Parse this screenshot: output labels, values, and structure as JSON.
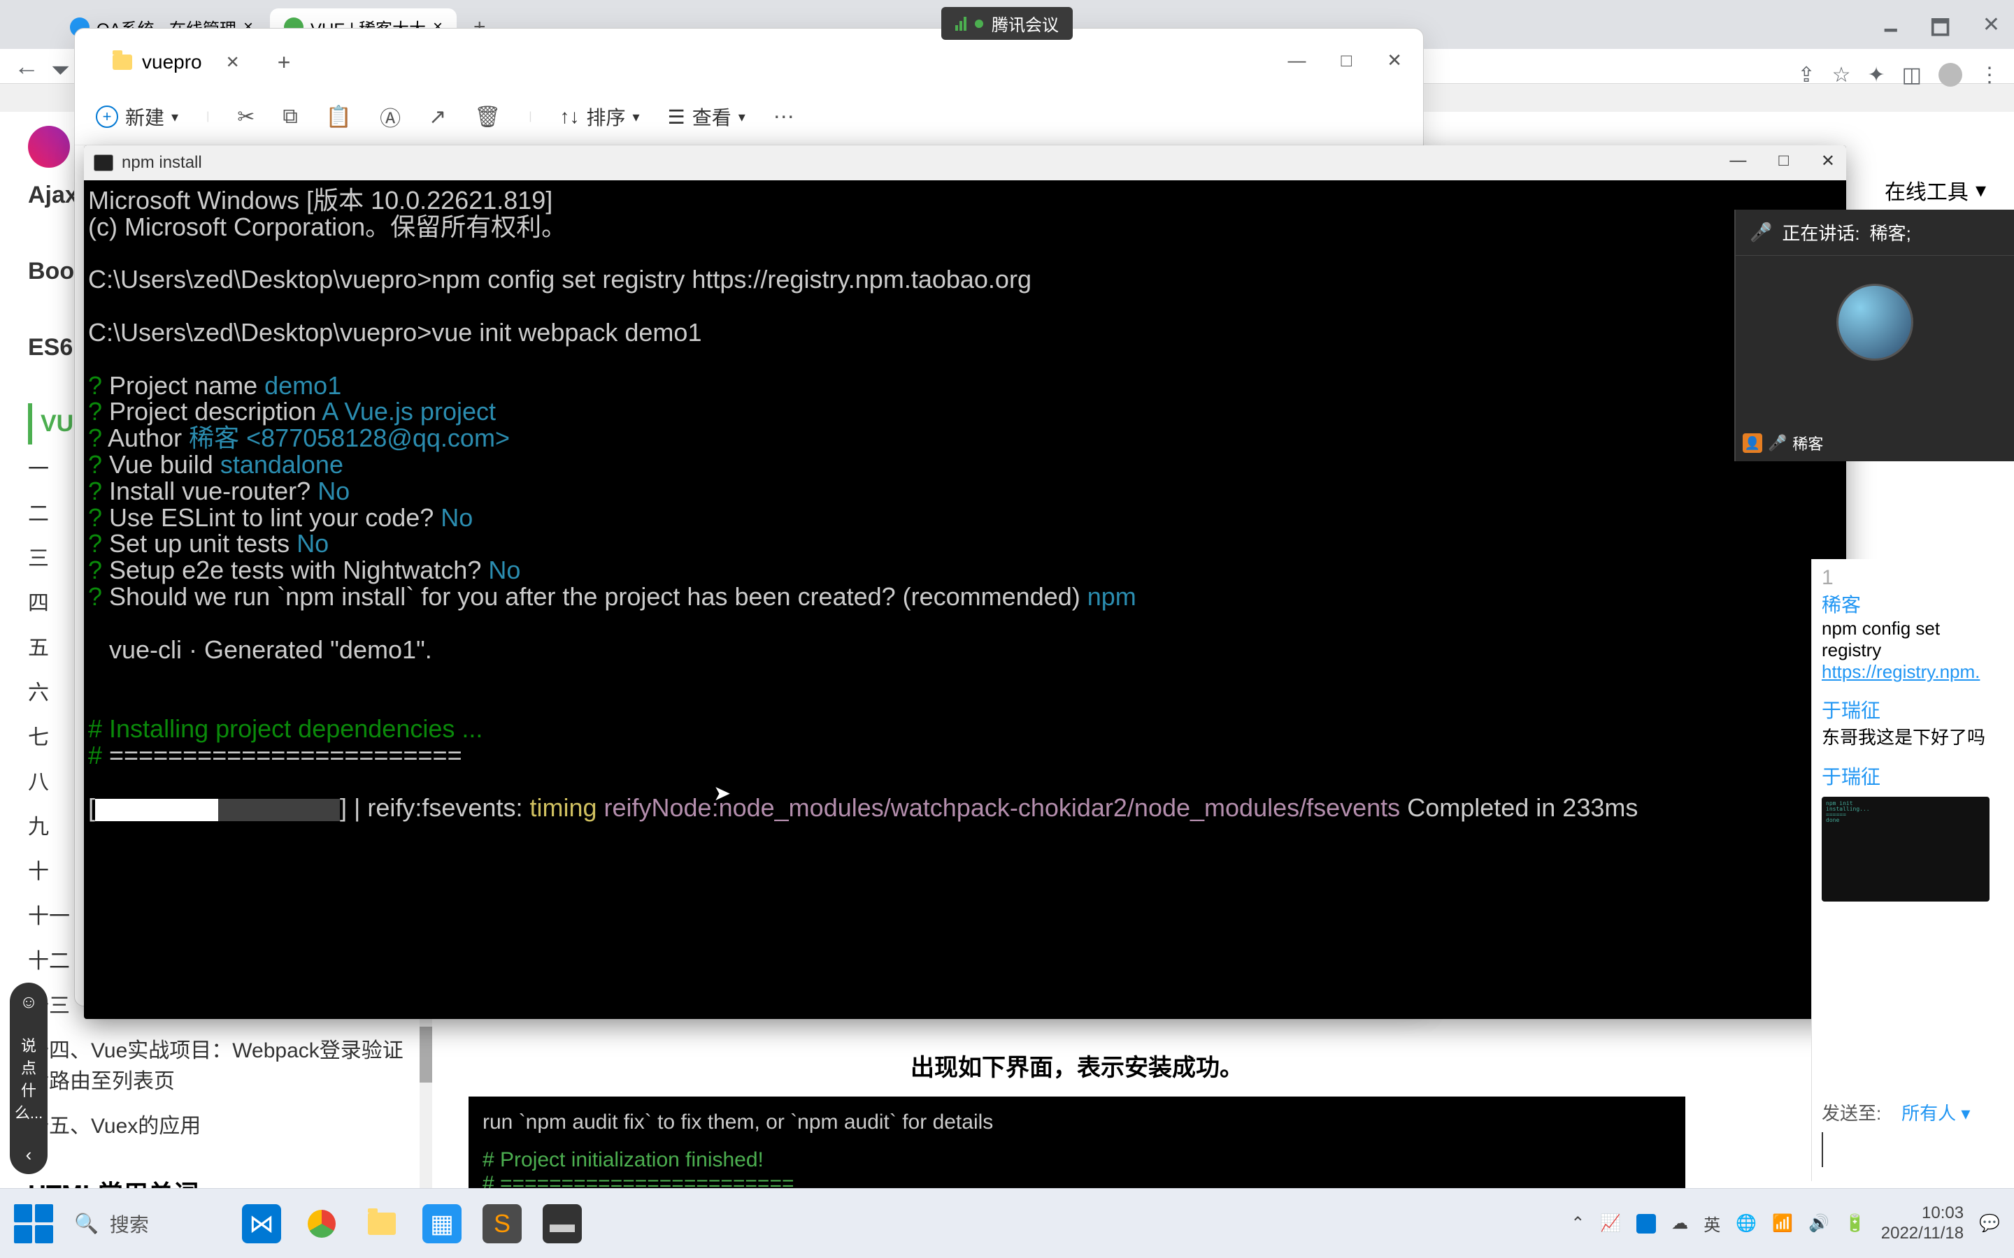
{
  "tencent_bar": {
    "label": "腾讯会议"
  },
  "chrome": {
    "tabs": [
      {
        "label": "OA系统 · 在线管理"
      },
      {
        "label": "VUE | 稀客大大"
      }
    ],
    "controls": {
      "min": "—",
      "max": "□",
      "close": "✕"
    }
  },
  "explorer": {
    "tab_title": "vuepro",
    "new_btn": "新建",
    "sort_btn": "排序",
    "view_btn": "查看",
    "controls": {
      "min": "—",
      "max": "□",
      "close": "✕"
    }
  },
  "terminal": {
    "title": "npm install",
    "lines": [
      {
        "segments": [
          {
            "t": "Microsoft Windows [版本 10.0.22621.819]",
            "c": "plain"
          }
        ]
      },
      {
        "segments": [
          {
            "t": "(c) Microsoft Corporation。保留所有权利。",
            "c": "plain"
          }
        ]
      },
      {
        "segments": [
          {
            "t": "",
            "c": "plain"
          }
        ]
      },
      {
        "segments": [
          {
            "t": "C:\\Users\\zed\\Desktop\\vuepro>",
            "c": "plain"
          },
          {
            "t": "npm config set registry https://registry.npm.taobao.org",
            "c": "plain"
          }
        ]
      },
      {
        "segments": [
          {
            "t": "",
            "c": "plain"
          }
        ]
      },
      {
        "segments": [
          {
            "t": "C:\\Users\\zed\\Desktop\\vuepro>",
            "c": "plain"
          },
          {
            "t": "vue init webpack demo1",
            "c": "plain"
          }
        ]
      },
      {
        "segments": [
          {
            "t": "",
            "c": "plain"
          }
        ]
      },
      {
        "segments": [
          {
            "t": "?",
            "c": "q"
          },
          {
            "t": " Project name ",
            "c": "plain"
          },
          {
            "t": "demo1",
            "c": "ans"
          }
        ]
      },
      {
        "segments": [
          {
            "t": "?",
            "c": "q"
          },
          {
            "t": " Project description ",
            "c": "plain"
          },
          {
            "t": "A Vue.js project",
            "c": "ans"
          }
        ]
      },
      {
        "segments": [
          {
            "t": "?",
            "c": "q"
          },
          {
            "t": " Author ",
            "c": "plain"
          },
          {
            "t": "稀客 <877058128@qq.com>",
            "c": "ans"
          }
        ]
      },
      {
        "segments": [
          {
            "t": "?",
            "c": "q"
          },
          {
            "t": " Vue build ",
            "c": "plain"
          },
          {
            "t": "standalone",
            "c": "ans"
          }
        ]
      },
      {
        "segments": [
          {
            "t": "?",
            "c": "q"
          },
          {
            "t": " Install vue-router? ",
            "c": "plain"
          },
          {
            "t": "No",
            "c": "ans"
          }
        ]
      },
      {
        "segments": [
          {
            "t": "?",
            "c": "q"
          },
          {
            "t": " Use ESLint to lint your code? ",
            "c": "plain"
          },
          {
            "t": "No",
            "c": "ans"
          }
        ]
      },
      {
        "segments": [
          {
            "t": "?",
            "c": "q"
          },
          {
            "t": " Set up unit tests ",
            "c": "plain"
          },
          {
            "t": "No",
            "c": "ans"
          }
        ]
      },
      {
        "segments": [
          {
            "t": "?",
            "c": "q"
          },
          {
            "t": " Setup e2e tests with Nightwatch? ",
            "c": "plain"
          },
          {
            "t": "No",
            "c": "ans"
          }
        ]
      },
      {
        "segments": [
          {
            "t": "?",
            "c": "q"
          },
          {
            "t": " Should we run `npm install` for you after the project has been created? (recommended) ",
            "c": "plain"
          },
          {
            "t": "npm",
            "c": "ans"
          }
        ]
      },
      {
        "segments": [
          {
            "t": "",
            "c": "plain"
          }
        ]
      },
      {
        "segments": [
          {
            "t": "   vue-cli · Generated \"demo1\".",
            "c": "plain"
          }
        ]
      },
      {
        "segments": [
          {
            "t": "",
            "c": "plain"
          }
        ]
      },
      {
        "segments": [
          {
            "t": "",
            "c": "plain"
          }
        ]
      },
      {
        "segments": [
          {
            "t": "#",
            "c": "q"
          },
          {
            "t": " Installing project dependencies ...",
            "c": "q"
          }
        ]
      },
      {
        "segments": [
          {
            "t": "#",
            "c": "q"
          },
          {
            "t": " ========================",
            "c": "plain"
          }
        ]
      },
      {
        "segments": [
          {
            "t": "",
            "c": "plain"
          }
        ]
      }
    ],
    "progress_line": {
      "prefix": "[",
      "suffix": "] | reify:fsevents: ",
      "timing": "timing",
      "path": " reifyNode:node_modules/watchpack-chokidar2/node_modules/fsevents",
      "done": " Completed in 233ms"
    }
  },
  "meeting": {
    "speaking_prefix": "正在讲话:",
    "speaker": "稀客;",
    "participant": "稀客"
  },
  "chat": {
    "msgs": [
      {
        "user": "稀客",
        "body": "npm config set registry",
        "link": "https://registry.npm."
      },
      {
        "user": "于瑞征",
        "body": "东哥我这是下好了吗"
      },
      {
        "user": "于瑞征",
        "img": true
      }
    ],
    "send_prefix": "发送至:",
    "send_target": "所有人"
  },
  "tools": {
    "label": "在线工具"
  },
  "bg_left": {
    "top_bold": [
      "Ajax",
      "Bootstrap",
      "ES6"
    ],
    "active": "VUE",
    "items": [
      "一",
      "二",
      "三",
      "四",
      "五",
      "六",
      "七",
      "八",
      "九",
      "十",
      "十一",
      "十二",
      "十三"
    ],
    "item14": "十四、Vue实战项目：Webpack登录验证后路由至列表页",
    "item15": "十五、Vuex的应用",
    "section2": "HTML常用单词"
  },
  "doc_bottom": {
    "title": "出现如下界面，表示安装成功。",
    "line0": "run `npm audit fix` to fix them, or `npm audit` for details",
    "line1": "# Project initialization finished!",
    "line2": "# ========================"
  },
  "scroll_widget": {
    "input_placeholder": "说点什么..."
  },
  "taskbar": {
    "search": "搜索",
    "time": "10:03",
    "date": "2022/11/18"
  }
}
